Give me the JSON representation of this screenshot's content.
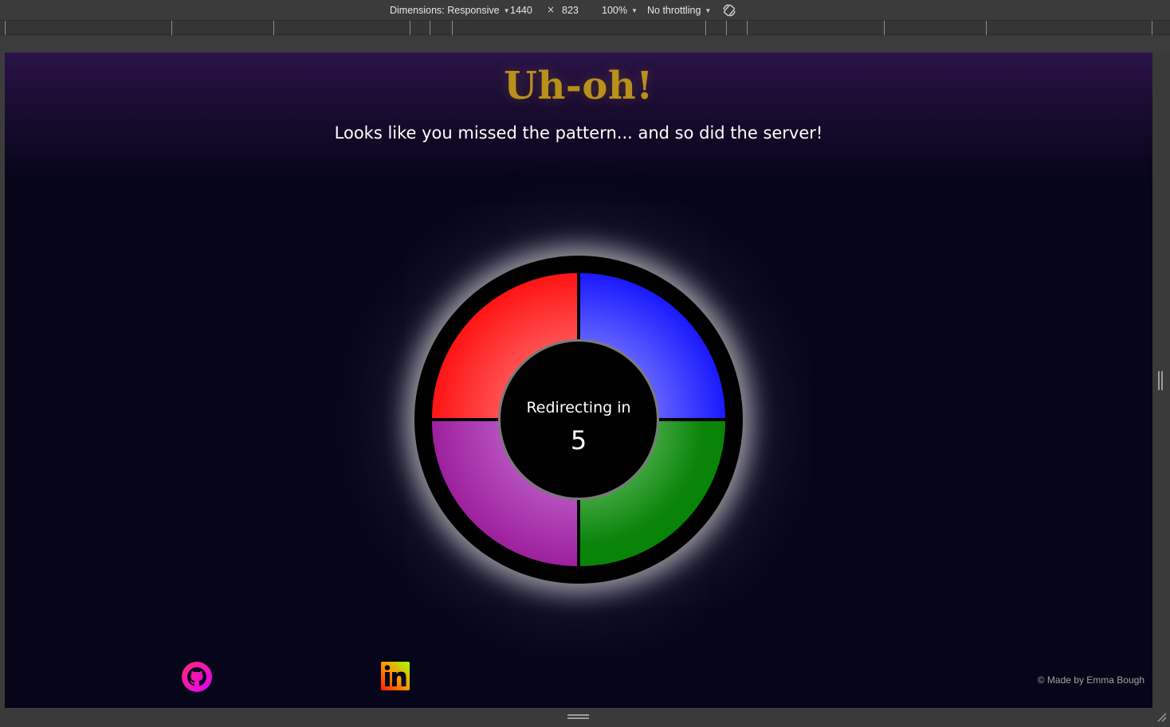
{
  "devtools": {
    "dimensions_label": "Dimensions: Responsive",
    "width": "1440",
    "times": "×",
    "height": "823",
    "zoom": "100%",
    "throttling": "No throttling",
    "rotate_icon": "rotate-icon"
  },
  "page": {
    "title": "Uh-oh!",
    "subtitle": "Looks like you missed the pattern... and so did the server!",
    "board": {
      "quadrant_colors": {
        "top_left": "#ff0000",
        "top_right": "#0000ff",
        "bottom_left": "#8e148f",
        "bottom_right": "#008000"
      },
      "redirect_label": "Redirecting in",
      "countdown": "5"
    },
    "footer": {
      "github_icon": "github-icon",
      "linkedin_icon": "linkedin-icon",
      "credit": "© Made by Emma Bough"
    }
  },
  "colors": {
    "title": "#b8901a",
    "background": "#06051a",
    "header_glow": "#2a1348"
  }
}
